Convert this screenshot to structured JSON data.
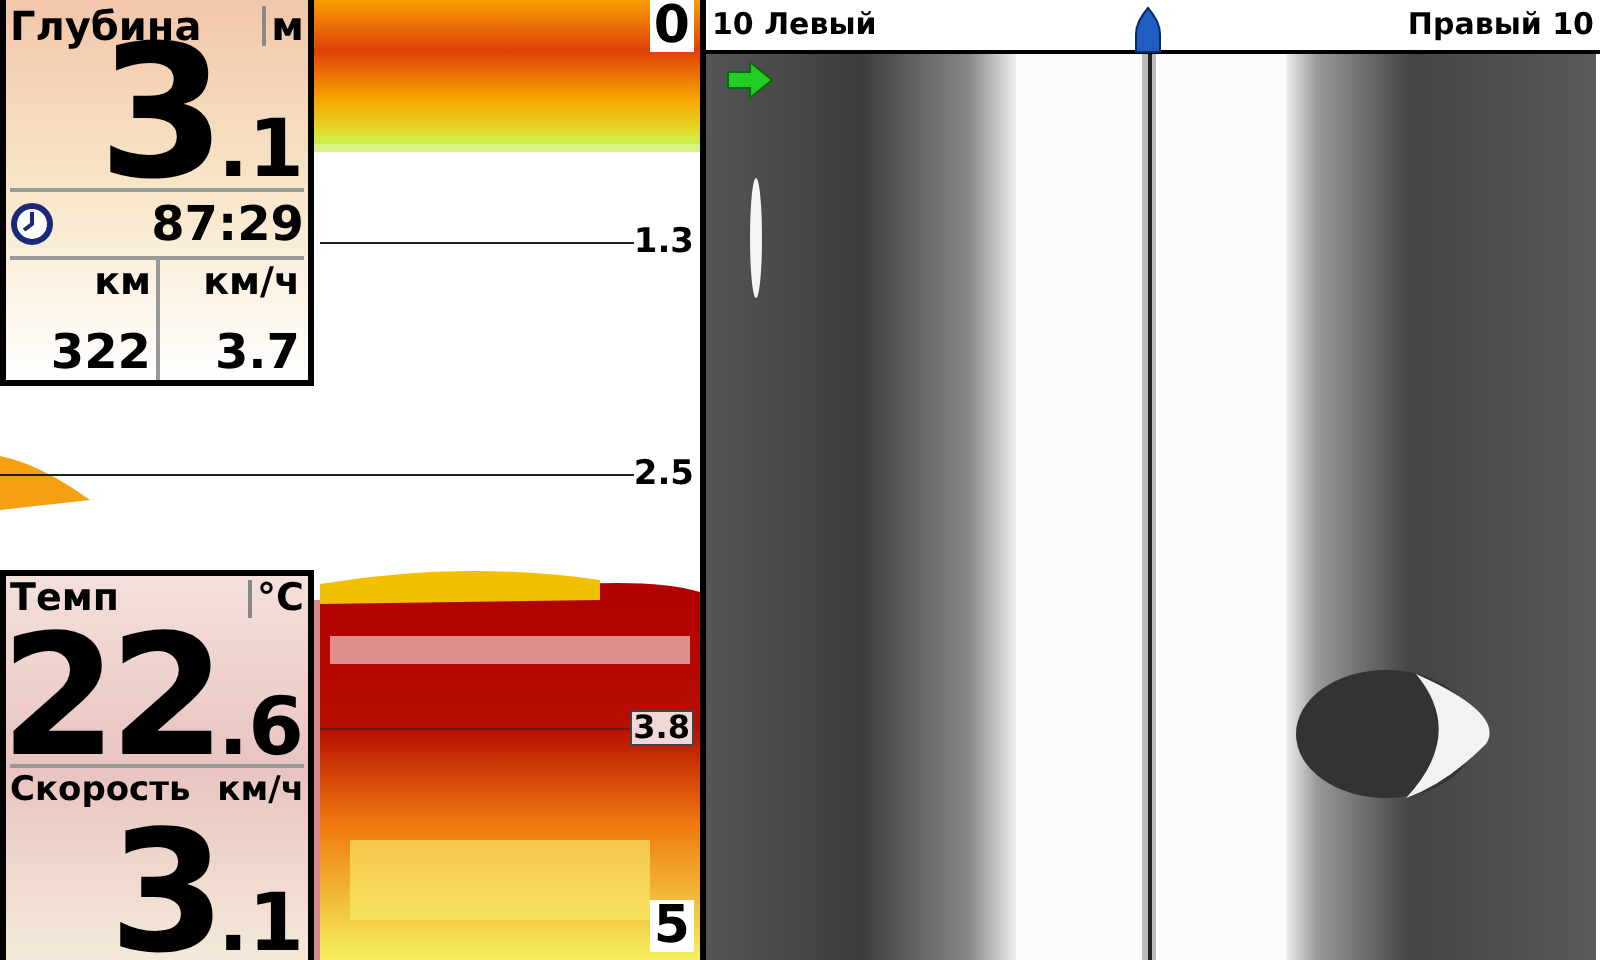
{
  "depth": {
    "label": "Глубина",
    "unit": "м",
    "value": "3",
    "decimal": ".1"
  },
  "timer": {
    "value": "87:29"
  },
  "trip": [
    {
      "unit": "км",
      "value": "322"
    },
    {
      "unit": "км/ч",
      "value": "3.7"
    }
  ],
  "temp": {
    "label": "Темп",
    "unit": "°C",
    "value": "22",
    "decimal": ".6"
  },
  "speed": {
    "label": "Скорость",
    "unit": "км/ч",
    "value": "3",
    "decimal": ".1"
  },
  "scale": [
    {
      "label": "0",
      "kind": "top"
    },
    {
      "label": "1.3",
      "kind": "line"
    },
    {
      "label": "2.5",
      "kind": "line"
    },
    {
      "label": "3.8",
      "kind": "cursor"
    },
    {
      "label": "5",
      "kind": "bottom"
    }
  ],
  "side_view": {
    "left_label": "10 Левый",
    "right_label": "Правый 10"
  }
}
